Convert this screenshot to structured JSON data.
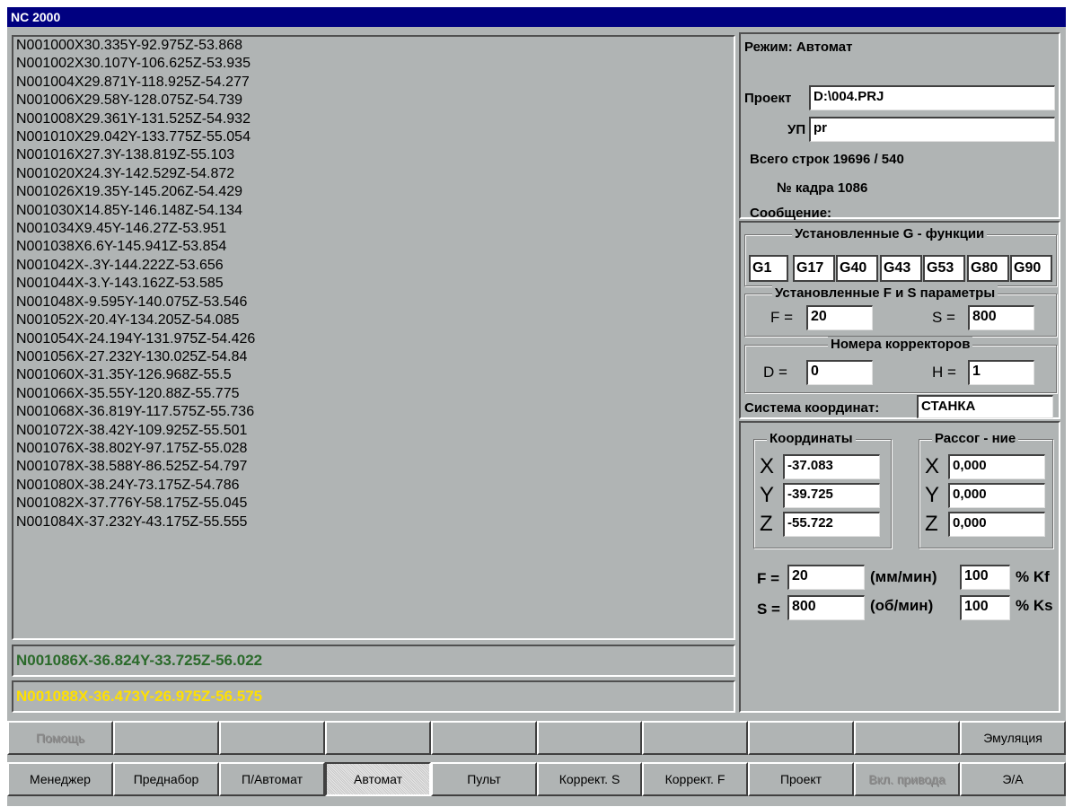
{
  "window": {
    "title": "NC 2000"
  },
  "program": {
    "lines": [
      "N001000X30.335Y-92.975Z-53.868",
      "N001002X30.107Y-106.625Z-53.935",
      "N001004X29.871Y-118.925Z-54.277",
      "N001006X29.58Y-128.075Z-54.739",
      "N001008X29.361Y-131.525Z-54.932",
      "N001010X29.042Y-133.775Z-55.054",
      "N001016X27.3Y-138.819Z-55.103",
      "N001020X24.3Y-142.529Z-54.872",
      "N001026X19.35Y-145.206Z-54.429",
      "N001030X14.85Y-146.148Z-54.134",
      "N001034X9.45Y-146.27Z-53.951",
      "N001038X6.6Y-145.941Z-53.854",
      "N001042X-.3Y-144.222Z-53.656",
      "N001044X-3.Y-143.162Z-53.585",
      "N001048X-9.595Y-140.075Z-53.546",
      "N001052X-20.4Y-134.205Z-54.085",
      "N001054X-24.194Y-131.975Z-54.426",
      "N001056X-27.232Y-130.025Z-54.84",
      "N001060X-31.35Y-126.968Z-55.5",
      "N001066X-35.55Y-120.88Z-55.775",
      "N001068X-36.819Y-117.575Z-55.736",
      "N001072X-38.42Y-109.925Z-55.501",
      "N001076X-38.802Y-97.175Z-55.028",
      "N001078X-38.588Y-86.525Z-54.797",
      "N001080X-38.24Y-73.175Z-54.786",
      "N001082X-37.776Y-58.175Z-55.045",
      "N001084X-37.232Y-43.175Z-55.555"
    ],
    "current_line": "N001086X-36.824Y-33.725Z-56.022",
    "next_line": "N001088X-36.473Y-26.975Z-56.575"
  },
  "status": {
    "mode": "Режим: Автомат",
    "project_label": "Проект",
    "project_value": "D:\\004.PRJ",
    "up_label": "УП",
    "up_value": "pr",
    "total_rows": "Всего строк 19696 / 540",
    "frame_no": "№ кадра  1086",
    "message_label": "Сообщение:"
  },
  "gfuncs": {
    "title": "Установленные G - функции",
    "items": [
      "G1",
      "G17",
      "G40",
      "G43",
      "G53",
      "G80",
      "G90"
    ]
  },
  "fs_params": {
    "title": "Установленные F и S параметры",
    "f_label": "F =",
    "f_value": "20",
    "s_label": "S =",
    "s_value": "800"
  },
  "correctors": {
    "title": "Номера корректоров",
    "d_label": "D =",
    "d_value": "0",
    "h_label": "H =",
    "h_value": "1"
  },
  "coord_system": {
    "label": "Система координат:",
    "value": "СТАНКА"
  },
  "coordinates": {
    "title": "Координаты",
    "x_label": "X",
    "x_value": "-37.083",
    "y_label": "Y",
    "y_value": "-39.725",
    "z_label": "Z",
    "z_value": "-55.722"
  },
  "mismatch": {
    "title": "Рассог - ние",
    "x_label": "X",
    "x_value": "0,000",
    "y_label": "Y",
    "y_value": "0,000",
    "z_label": "Z",
    "z_value": "0,000"
  },
  "feed": {
    "f_label": "F =",
    "f_value": "20",
    "f_unit": "(мм/мин)",
    "f_pct": "100",
    "f_pct_label": "% Kf",
    "s_label": "S =",
    "s_value": "800",
    "s_unit": "(об/мин)",
    "s_pct": "100",
    "s_pct_label": "% Ks"
  },
  "toolbar_top": [
    "Помощь",
    "",
    "",
    "",
    "",
    "",
    "",
    "",
    "",
    "Эмуляция"
  ],
  "toolbar_bottom": [
    "Менеджер",
    "Преднабор",
    "П/Автомат",
    "Автомат",
    "Пульт",
    "Коррект. S",
    "Коррект. F",
    "Проект",
    "Вкл. привода",
    "Э/А"
  ],
  "colors": {
    "titlebar": "#000080",
    "panel": "#b0b4b4",
    "current_line": "#2a6a2a",
    "next_line": "#ffe000"
  }
}
